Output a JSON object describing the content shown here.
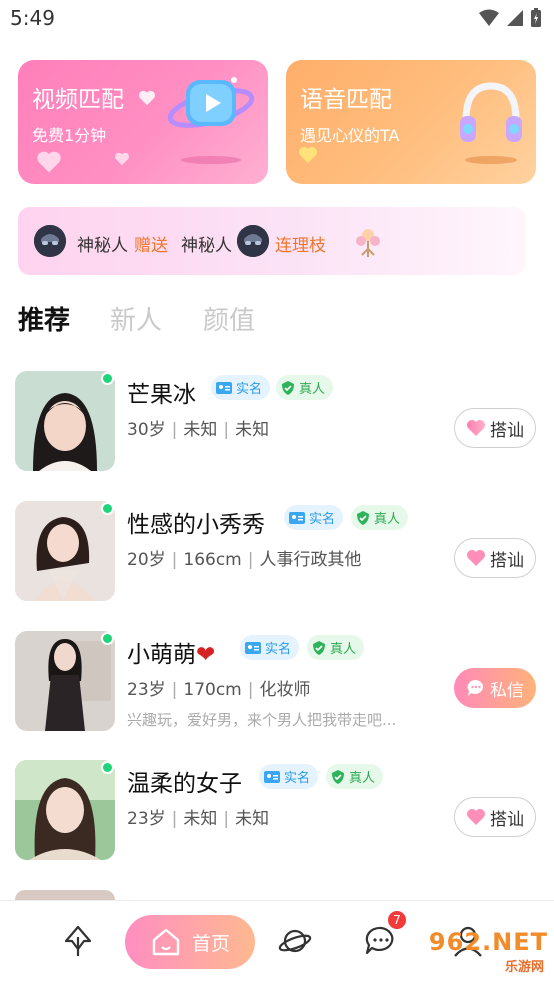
{
  "status_bar": {
    "time": "5:49"
  },
  "cards": {
    "video": {
      "title": "视频匹配",
      "subtitle": "免费1分钟"
    },
    "voice": {
      "title": "语音匹配",
      "subtitle": "遇见心仪的TA"
    }
  },
  "gift_ticker": {
    "sender": "神秘人",
    "action": "赠送",
    "receiver": "神秘人",
    "gift": "连理枝"
  },
  "tabs": [
    {
      "label": "推荐",
      "active": true
    },
    {
      "label": "新人",
      "active": false
    },
    {
      "label": "颜值",
      "active": false
    }
  ],
  "verify_labels": {
    "real": "实名",
    "person": "真人"
  },
  "users": [
    {
      "name": "芒果冰",
      "age": "30岁",
      "height": "未知",
      "job": "未知",
      "bio": "",
      "action": "搭讪"
    },
    {
      "name": "性感的小秀秀",
      "age": "20岁",
      "height": "166cm",
      "job": "人事行政其他",
      "bio": "",
      "action": "搭讪"
    },
    {
      "name": "小萌萌",
      "emoji": "❤",
      "age": "23岁",
      "height": "170cm",
      "job": "化妆师",
      "bio": "兴趣玩，爱好男，来个男人把我带走吧...",
      "action": "私信"
    },
    {
      "name": "温柔的女子",
      "age": "23岁",
      "height": "未知",
      "job": "未知",
      "bio": "",
      "action": "搭讪"
    }
  ],
  "bottom_nav": {
    "home_label": "首页",
    "messages_badge": "7"
  },
  "watermark": {
    "brand": "962.NET",
    "text": "乐游网"
  },
  "colors": {
    "online": "#20d47a",
    "accent_pink": "#ff8ec1",
    "accent_orange": "#ffb27a",
    "badge_red": "#f23a3a"
  }
}
